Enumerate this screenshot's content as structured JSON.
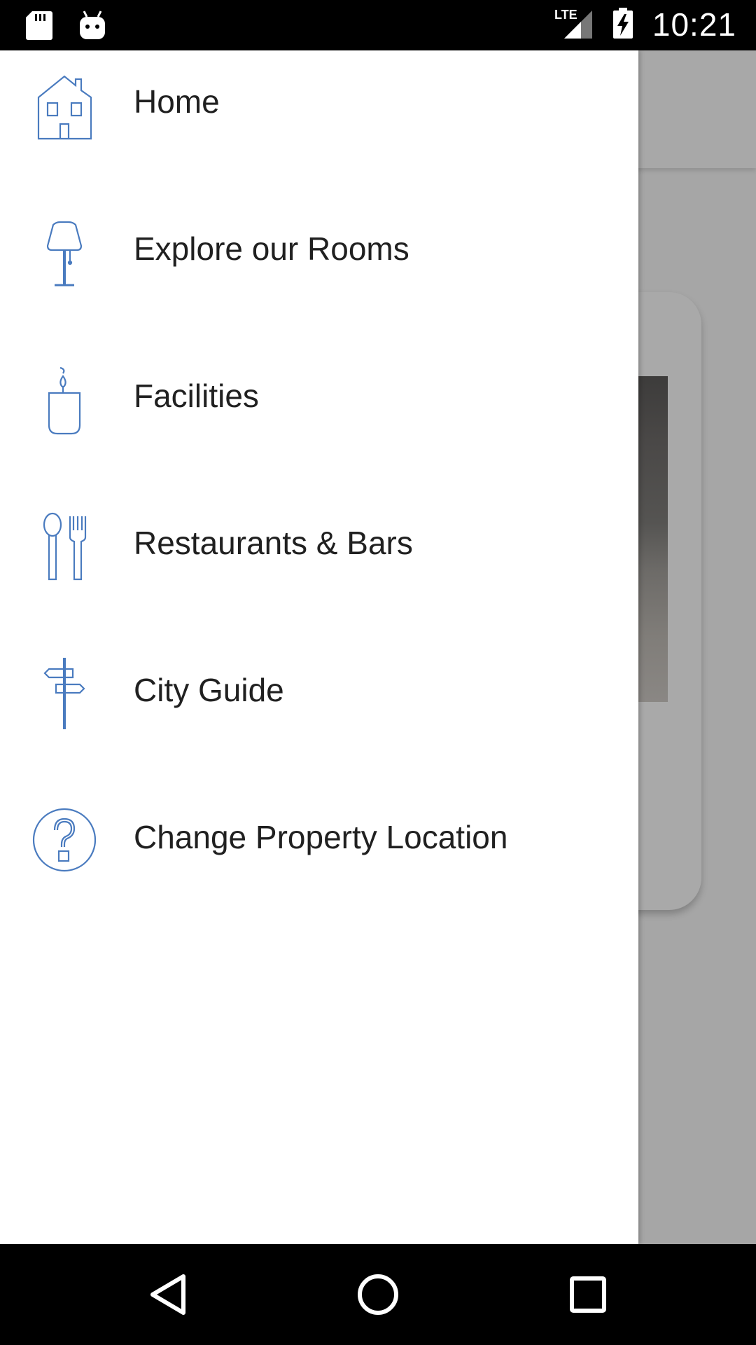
{
  "status_bar": {
    "time": "10:21",
    "network_label": "LTE",
    "icons": [
      "sd-card-icon",
      "android-debug-icon",
      "lte-signal-icon",
      "battery-charging-icon"
    ]
  },
  "drawer": {
    "items": [
      {
        "label": "Home",
        "icon": "house-icon"
      },
      {
        "label": "Explore our Rooms",
        "icon": "lamp-icon"
      },
      {
        "label": "Facilities",
        "icon": "candle-icon"
      },
      {
        "label": "Restaurants & Bars",
        "icon": "spoon-fork-icon"
      },
      {
        "label": "City Guide",
        "icon": "signpost-icon"
      },
      {
        "label": "Change Property Location",
        "icon": "question-circle-icon"
      }
    ]
  },
  "nav_bar": {
    "buttons": [
      "back-icon",
      "home-circle-icon",
      "recents-square-icon"
    ]
  },
  "colors": {
    "icon_blue": "#4a7bbf",
    "scrim_gray": "#a6a6a6",
    "drawer_bg": "#ffffff",
    "label_text": "#202020"
  }
}
